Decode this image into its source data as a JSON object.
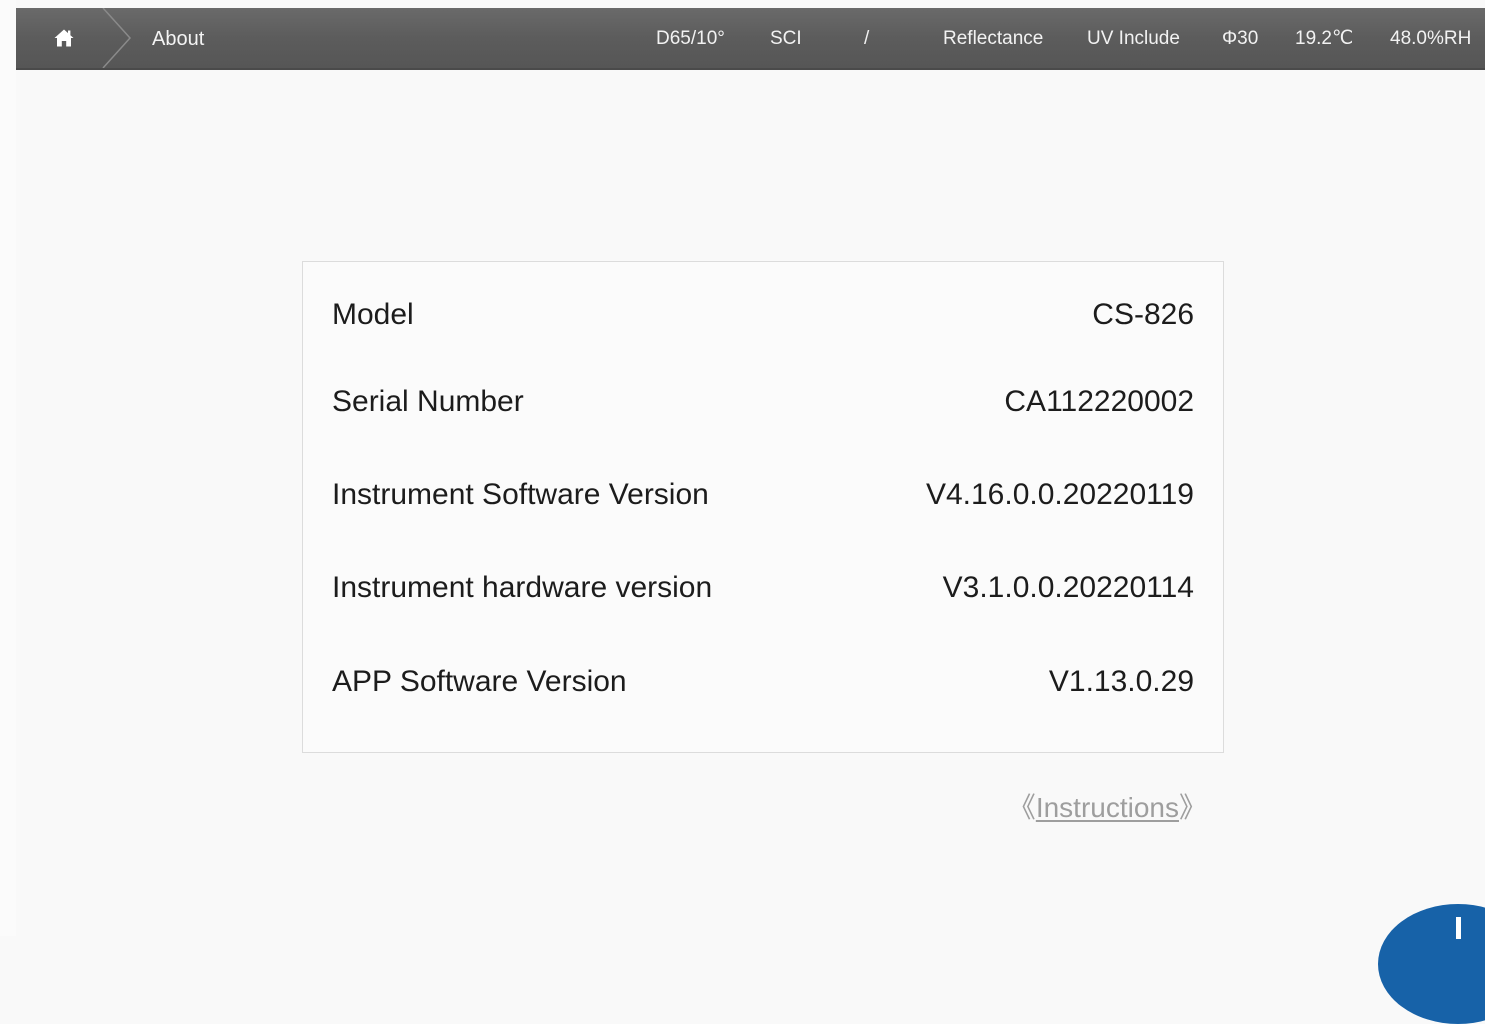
{
  "header": {
    "breadcrumb": "About",
    "status": {
      "illuminant": "D65/10°",
      "mode": "SCI",
      "divider": "/",
      "measurement": "Reflectance",
      "uv": "UV Include",
      "aperture": "Φ30",
      "temperature": "19.2℃",
      "humidity": "48.0%RH"
    }
  },
  "info": {
    "rows": [
      {
        "label": "Model",
        "value": "CS-826"
      },
      {
        "label": "Serial Number",
        "value": "CA112220002"
      },
      {
        "label": "Instrument Software Version",
        "value": "V4.16.0.0.20220119"
      },
      {
        "label": "Instrument hardware version",
        "value": "V3.1.0.0.20220114"
      },
      {
        "label": "APP Software Version",
        "value": "V1.13.0.29"
      }
    ]
  },
  "instructions": {
    "open_bracket": "《",
    "label": "Instructions",
    "close_bracket": "》"
  },
  "icons": {
    "home": "home-icon",
    "fab": "plus-icon"
  },
  "colors": {
    "topbar": "#5e5e5e",
    "background": "#f9f9f9",
    "accent": "#1762a8",
    "link": "#9e9e9e"
  }
}
